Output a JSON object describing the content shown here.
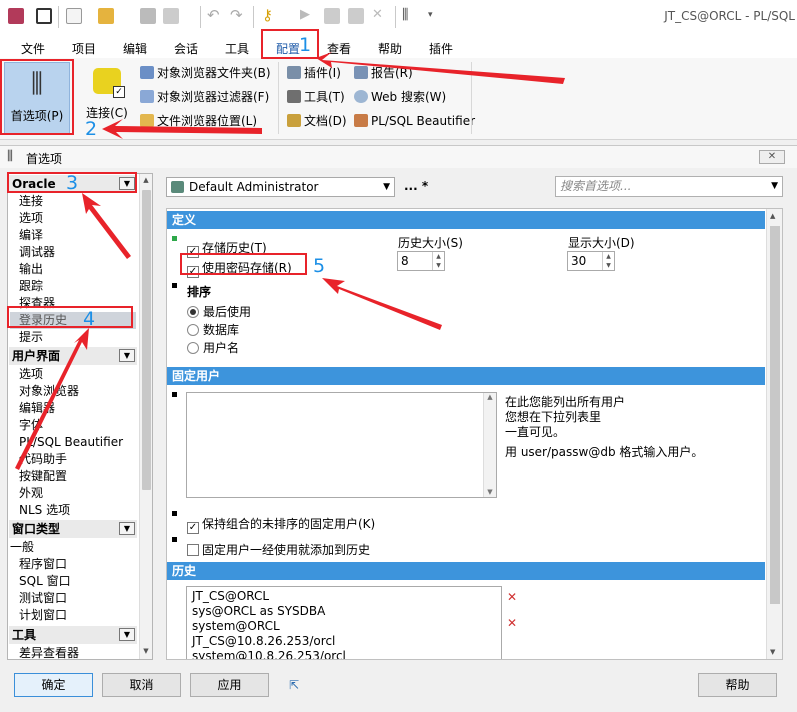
{
  "app_title": "JT_CS@ORCL - PL/SQL",
  "menu": [
    "文件",
    "项目",
    "编辑",
    "会话",
    "工具",
    "配置",
    "查看",
    "帮助",
    "插件"
  ],
  "ribbon": {
    "preferences": "首选项(P)",
    "connect": "连接(C)",
    "group1": [
      "对象浏览器文件夹(B)",
      "对象浏览器过滤器(F)",
      "文件浏览器位置(L)"
    ],
    "group2": [
      "插件(I)",
      "工具(T)",
      "文档(D)"
    ],
    "group3": [
      "报告(R)",
      "Web 搜索(W)",
      "PL/SQL Beautifier"
    ]
  },
  "annotations": [
    "1",
    "2",
    "3",
    "4",
    "5"
  ],
  "dialog": {
    "title": "首选项",
    "profile": "Default Administrator",
    "profile_extra": "...  *",
    "search_placeholder": "搜索首选项...",
    "tree": {
      "oracle": {
        "label": "Oracle",
        "items": [
          "连接",
          "选项",
          "编译",
          "调试器",
          "输出",
          "跟踪",
          "探查器",
          "登录历史",
          "提示"
        ]
      },
      "ui": {
        "label": "用户界面",
        "items": [
          "选项",
          "对象浏览器",
          "编辑器",
          "字体",
          "PL/SQL Beautifier",
          "代码助手",
          "按键配置",
          "外观",
          "NLS 选项"
        ]
      },
      "window": {
        "label": "窗口类型",
        "items": [
          "一般",
          "程序窗口",
          "SQL 窗口",
          "测试窗口",
          "计划窗口"
        ]
      },
      "tools": {
        "label": "工具",
        "items": [
          "差异查看器"
        ]
      }
    },
    "definition": {
      "header": "定义",
      "store_history": "存储历史(T)",
      "store_password": "使用密码存储(R)",
      "history_size_label": "历史大小(S)",
      "history_size": "8",
      "display_size_label": "显示大小(D)",
      "display_size": "30"
    },
    "sort": {
      "label": "排序",
      "options": [
        "最后使用",
        "数据库",
        "用户名"
      ],
      "selected": 0
    },
    "fixed_users": {
      "header": "固定用户",
      "help1": "在此您能列出所有用户",
      "help2": "您想在下拉列表里",
      "help3": "一直可见。",
      "help4": "用 user/passw@db 格式输入用户。",
      "keep_unsorted": "保持组合的未排序的固定用户(K)",
      "add_to_history": "固定用户一经使用就添加到历史"
    },
    "history": {
      "header": "历史",
      "entries": [
        "JT_CS@ORCL",
        "sys@ORCL as SYSDBA",
        "system@ORCL",
        "JT_CS@10.8.26.253/orcl",
        "system@10.8.26.253/orcl"
      ]
    },
    "buttons": {
      "ok": "确定",
      "cancel": "取消",
      "apply": "应用",
      "help": "帮助"
    }
  }
}
